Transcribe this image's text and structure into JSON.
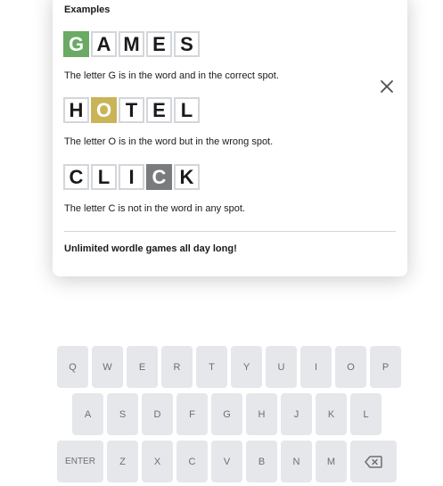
{
  "modal": {
    "heading": "Examples",
    "examples": [
      {
        "tiles": [
          {
            "letter": "G",
            "state": "correct"
          },
          {
            "letter": "A",
            "state": "empty"
          },
          {
            "letter": "M",
            "state": "empty"
          },
          {
            "letter": "E",
            "state": "empty"
          },
          {
            "letter": "S",
            "state": "empty"
          }
        ],
        "description": "The letter G is in the word and in the correct spot."
      },
      {
        "tiles": [
          {
            "letter": "H",
            "state": "empty"
          },
          {
            "letter": "O",
            "state": "present"
          },
          {
            "letter": "T",
            "state": "empty"
          },
          {
            "letter": "E",
            "state": "empty"
          },
          {
            "letter": "L",
            "state": "empty"
          }
        ],
        "description": "The letter O is in the word but in the wrong spot."
      },
      {
        "tiles": [
          {
            "letter": "C",
            "state": "empty"
          },
          {
            "letter": "L",
            "state": "empty"
          },
          {
            "letter": "I",
            "state": "empty"
          },
          {
            "letter": "C",
            "state": "absent"
          },
          {
            "letter": "K",
            "state": "empty"
          }
        ],
        "description": "The letter C is not in the word in any spot."
      }
    ],
    "footer": "Unlimited wordle games all day long!",
    "close_icon": "close-icon"
  },
  "keyboard": {
    "row1": [
      "Q",
      "W",
      "E",
      "R",
      "T",
      "Y",
      "U",
      "I",
      "O",
      "P"
    ],
    "row2": [
      "A",
      "S",
      "D",
      "F",
      "G",
      "H",
      "J",
      "K",
      "L"
    ],
    "row3": [
      "Z",
      "X",
      "C",
      "V",
      "B",
      "N",
      "M"
    ],
    "enter_label": "ENTER",
    "backspace_icon": "backspace-icon"
  },
  "colors": {
    "correct": "#6aaa64",
    "present": "#c9b458",
    "absent": "#787c7e",
    "key_bg": "#e5e7ea",
    "key_text": "#6b6f73"
  }
}
